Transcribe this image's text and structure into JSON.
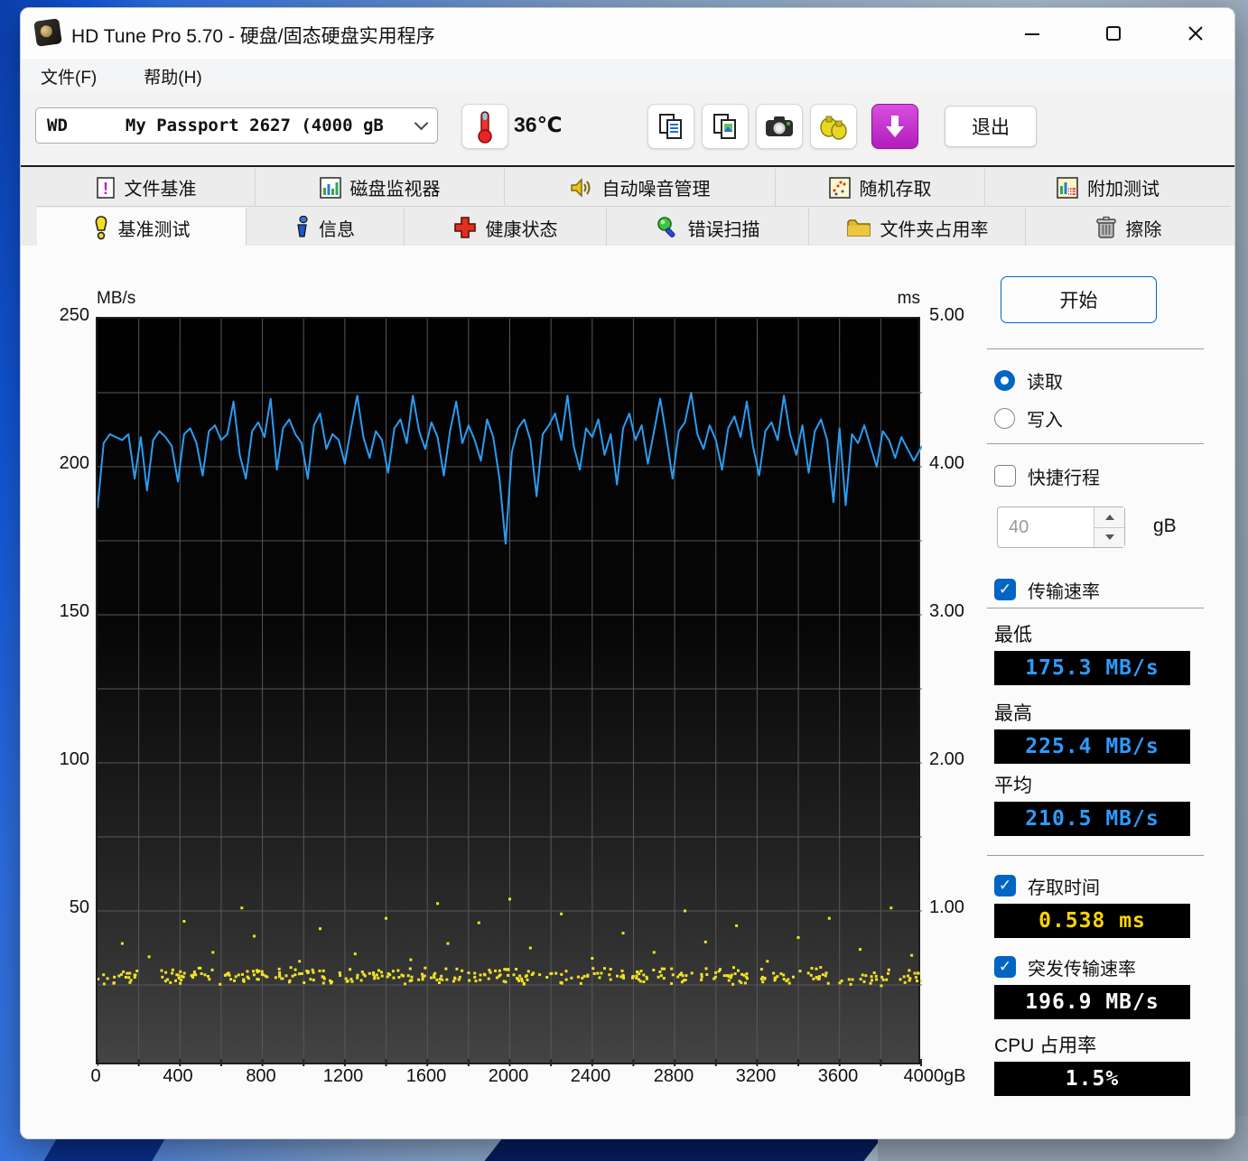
{
  "window": {
    "title": "HD Tune Pro 5.70 - 硬盘/固态硬盘实用程序"
  },
  "menu": {
    "items": [
      "文件(F)",
      "帮助(H)"
    ]
  },
  "toolbar": {
    "drive_vendor": "WD",
    "drive_model": "My Passport 2627 (4000 gB",
    "temperature": "36℃",
    "exit_label": "退出"
  },
  "tabs": {
    "row1": [
      "文件基准",
      "磁盘监视器",
      "自动噪音管理",
      "随机存取",
      "附加测试"
    ],
    "row2": [
      "基准测试",
      "信息",
      "健康状态",
      "错误扫描",
      "文件夹占用率",
      "擦除"
    ],
    "active": "基准测试"
  },
  "panel": {
    "start_label": "开始",
    "read_label": "读取",
    "write_label": "写入",
    "short_stroke_label": "快捷行程",
    "short_stroke_value": "40",
    "short_stroke_unit": "gB",
    "transfer_rate_label": "传输速率",
    "min_label": "最低",
    "min_value": "175.3 MB/s",
    "max_label": "最高",
    "max_value": "225.4 MB/s",
    "avg_label": "平均",
    "avg_value": "210.5 MB/s",
    "access_time_label": "存取时间",
    "access_time_value": "0.538 ms",
    "burst_rate_label": "突发传输速率",
    "burst_rate_value": "196.9 MB/s",
    "cpu_label": "CPU 占用率",
    "cpu_value": "1.5%"
  },
  "chart_data": {
    "type": "line",
    "title": "HD Tune read benchmark: transfer rate line (MB/s) + access time scatter (ms)",
    "left_axis": {
      "label": "MB/s",
      "min": 0,
      "max": 250,
      "tick_labels": [
        "250",
        "200",
        "150",
        "100",
        "50"
      ]
    },
    "right_axis": {
      "label": "ms",
      "min": 0,
      "max": 5,
      "tick_labels": [
        "5.00",
        "4.00",
        "3.00",
        "2.00",
        "1.00"
      ]
    },
    "x_axis": {
      "unit": "gB",
      "min": 0,
      "max": 4000,
      "tick_labels": [
        "0",
        "400",
        "800",
        "1200",
        "1600",
        "2000",
        "2400",
        "2800",
        "3200",
        "3600",
        "4000gB"
      ]
    },
    "grid": {
      "x_step_gb": 200,
      "y_step_mbs": 25,
      "color": "#585858"
    },
    "stats": {
      "min_mbs": 175.3,
      "max_mbs": 225.4,
      "avg_mbs": 210.5,
      "access_time_ms": 0.538,
      "burst_mbs": 196.9,
      "cpu_pct": 1.5
    },
    "series": [
      {
        "name": "read-transfer-rate",
        "unit": "MB/s",
        "color": "#2b9cf2",
        "points": [
          [
            0,
            186
          ],
          [
            30,
            208
          ],
          [
            60,
            211
          ],
          [
            90,
            210
          ],
          [
            120,
            209
          ],
          [
            150,
            211
          ],
          [
            180,
            196
          ],
          [
            210,
            210
          ],
          [
            240,
            192
          ],
          [
            270,
            209
          ],
          [
            300,
            212
          ],
          [
            330,
            210
          ],
          [
            360,
            207
          ],
          [
            390,
            195
          ],
          [
            420,
            211
          ],
          [
            450,
            213
          ],
          [
            480,
            208
          ],
          [
            510,
            197
          ],
          [
            540,
            212
          ],
          [
            570,
            214
          ],
          [
            600,
            209
          ],
          [
            630,
            211
          ],
          [
            660,
            222
          ],
          [
            690,
            204
          ],
          [
            720,
            196
          ],
          [
            750,
            212
          ],
          [
            780,
            215
          ],
          [
            810,
            210
          ],
          [
            840,
            223
          ],
          [
            870,
            199
          ],
          [
            900,
            213
          ],
          [
            930,
            216
          ],
          [
            960,
            211
          ],
          [
            990,
            208
          ],
          [
            1020,
            196
          ],
          [
            1050,
            214
          ],
          [
            1080,
            218
          ],
          [
            1110,
            206
          ],
          [
            1140,
            211
          ],
          [
            1170,
            209
          ],
          [
            1200,
            201
          ],
          [
            1230,
            213
          ],
          [
            1260,
            224
          ],
          [
            1290,
            210
          ],
          [
            1320,
            203
          ],
          [
            1350,
            212
          ],
          [
            1380,
            209
          ],
          [
            1410,
            198
          ],
          [
            1440,
            213
          ],
          [
            1470,
            216
          ],
          [
            1500,
            208
          ],
          [
            1530,
            224
          ],
          [
            1560,
            212
          ],
          [
            1590,
            206
          ],
          [
            1620,
            215
          ],
          [
            1650,
            210
          ],
          [
            1680,
            197
          ],
          [
            1710,
            212
          ],
          [
            1740,
            222
          ],
          [
            1770,
            208
          ],
          [
            1800,
            214
          ],
          [
            1830,
            209
          ],
          [
            1860,
            202
          ],
          [
            1890,
            216
          ],
          [
            1920,
            210
          ],
          [
            1950,
            196
          ],
          [
            1980,
            174
          ],
          [
            2010,
            205
          ],
          [
            2040,
            213
          ],
          [
            2070,
            216
          ],
          [
            2100,
            209
          ],
          [
            2130,
            190
          ],
          [
            2160,
            211
          ],
          [
            2190,
            214
          ],
          [
            2220,
            218
          ],
          [
            2250,
            209
          ],
          [
            2280,
            224
          ],
          [
            2310,
            207
          ],
          [
            2340,
            199
          ],
          [
            2370,
            213
          ],
          [
            2400,
            210
          ],
          [
            2430,
            216
          ],
          [
            2460,
            204
          ],
          [
            2490,
            211
          ],
          [
            2520,
            194
          ],
          [
            2550,
            213
          ],
          [
            2580,
            218
          ],
          [
            2610,
            209
          ],
          [
            2640,
            214
          ],
          [
            2670,
            201
          ],
          [
            2700,
            212
          ],
          [
            2730,
            223
          ],
          [
            2760,
            210
          ],
          [
            2790,
            196
          ],
          [
            2820,
            212
          ],
          [
            2850,
            215
          ],
          [
            2880,
            225
          ],
          [
            2910,
            211
          ],
          [
            2940,
            206
          ],
          [
            2970,
            214
          ],
          [
            3000,
            209
          ],
          [
            3030,
            199
          ],
          [
            3060,
            213
          ],
          [
            3090,
            217
          ],
          [
            3120,
            210
          ],
          [
            3150,
            222
          ],
          [
            3180,
            207
          ],
          [
            3210,
            197
          ],
          [
            3240,
            212
          ],
          [
            3270,
            215
          ],
          [
            3300,
            209
          ],
          [
            3330,
            224
          ],
          [
            3360,
            211
          ],
          [
            3390,
            204
          ],
          [
            3420,
            214
          ],
          [
            3450,
            198
          ],
          [
            3480,
            212
          ],
          [
            3510,
            216
          ],
          [
            3540,
            209
          ],
          [
            3570,
            188
          ],
          [
            3600,
            213
          ],
          [
            3630,
            187
          ],
          [
            3660,
            211
          ],
          [
            3690,
            208
          ],
          [
            3720,
            214
          ],
          [
            3750,
            207
          ],
          [
            3780,
            200
          ],
          [
            3810,
            212
          ],
          [
            3840,
            209
          ],
          [
            3870,
            203
          ],
          [
            3900,
            210
          ],
          [
            3930,
            206
          ],
          [
            3960,
            202
          ],
          [
            4000,
            207
          ]
        ]
      },
      {
        "name": "access-time",
        "unit": "ms",
        "color": "#f0e224",
        "dense_band": {
          "count": 380,
          "y_min": 0.49,
          "y_max": 0.63,
          "seed": 13
        },
        "outliers": [
          [
            120,
            0.78
          ],
          [
            250,
            0.69
          ],
          [
            420,
            0.93
          ],
          [
            560,
            0.72
          ],
          [
            700,
            1.02
          ],
          [
            760,
            0.83
          ],
          [
            980,
            0.66
          ],
          [
            1080,
            0.88
          ],
          [
            1250,
            0.71
          ],
          [
            1400,
            0.95
          ],
          [
            1520,
            0.67
          ],
          [
            1650,
            1.05
          ],
          [
            1700,
            0.78
          ],
          [
            1850,
            0.92
          ],
          [
            2000,
            1.08
          ],
          [
            2100,
            0.75
          ],
          [
            2250,
            0.98
          ],
          [
            2400,
            0.68
          ],
          [
            2550,
            0.85
          ],
          [
            2700,
            0.72
          ],
          [
            2850,
            1.0
          ],
          [
            2950,
            0.79
          ],
          [
            3100,
            0.9
          ],
          [
            3250,
            0.66
          ],
          [
            3400,
            0.82
          ],
          [
            3550,
            0.95
          ],
          [
            3700,
            0.74
          ],
          [
            3850,
            1.02
          ],
          [
            3950,
            0.7
          ]
        ]
      }
    ]
  }
}
